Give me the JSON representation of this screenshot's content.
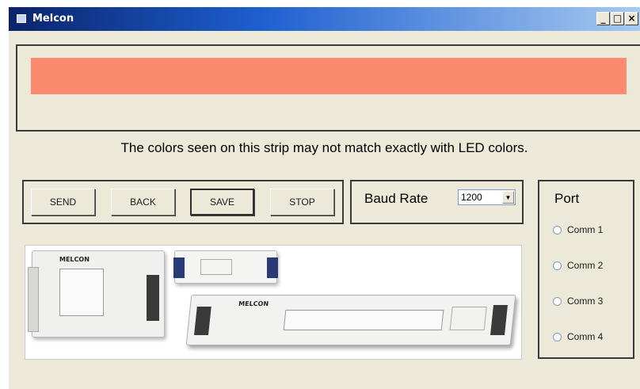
{
  "window": {
    "title": "Melcon"
  },
  "titlebar_buttons": {
    "minimize": "_",
    "maximize": "□",
    "close": "×"
  },
  "color_strip": {
    "color": "#fc8a6e"
  },
  "notice": "The colors seen on this strip may not match exactly with LED colors.",
  "buttons": {
    "send": "SEND",
    "back": "BACK",
    "save": "SAVE",
    "stop": "STOP"
  },
  "baud": {
    "label": "Baud Rate",
    "selected": "1200"
  },
  "port": {
    "title": "Port",
    "options": [
      "Comm 1",
      "Comm 2",
      "Comm 3",
      "Comm 4"
    ]
  },
  "products": {
    "brand": "MELCON"
  }
}
